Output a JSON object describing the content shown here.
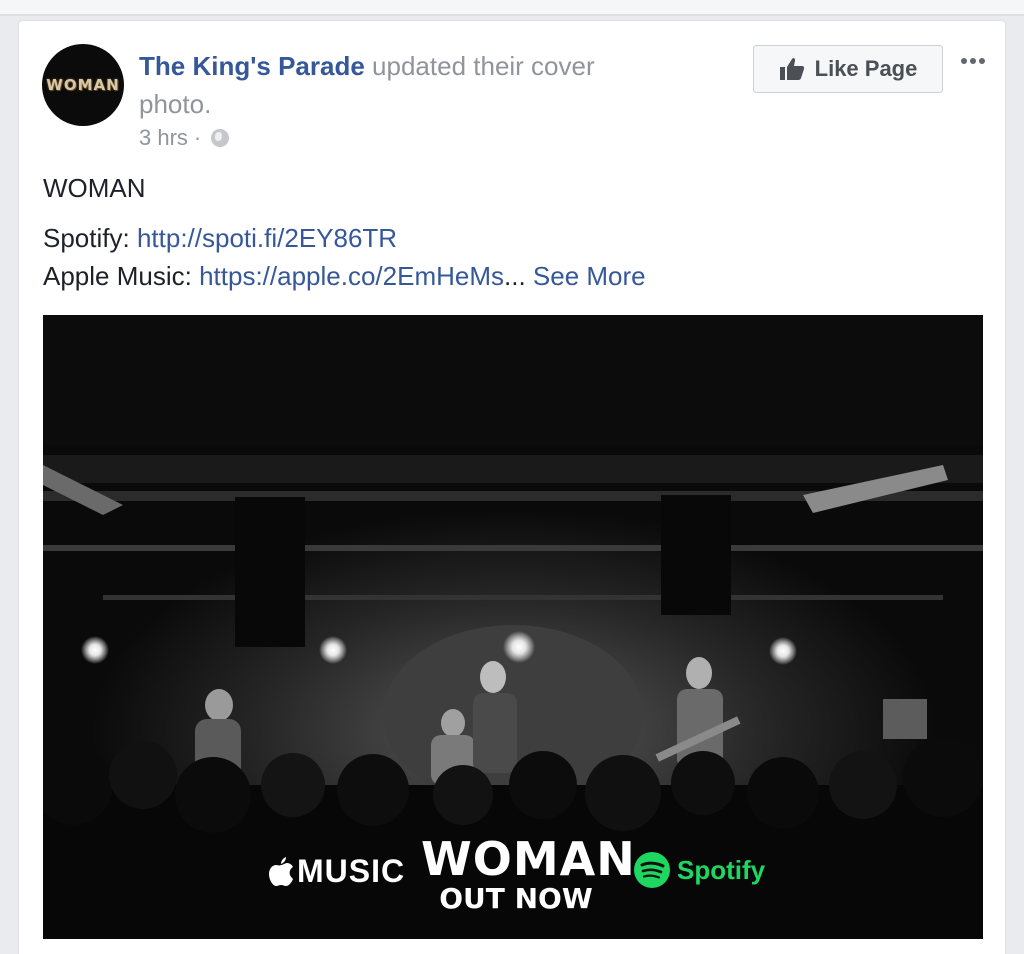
{
  "post": {
    "avatar_text": "WOMAN",
    "page_name": "The King's Parade",
    "action_text": "updated their cover photo.",
    "time": "3 hrs",
    "separator": "·",
    "privacy_icon": "globe-icon"
  },
  "actions": {
    "like_page_label": "Like Page",
    "like_icon": "thumbs-up-icon",
    "more_icon": "more-options-icon"
  },
  "body": {
    "title": "WOMAN",
    "spotify_label": "Spotify:",
    "spotify_link": "http://spoti.fi/2EY86TR",
    "apple_label": "Apple Music:",
    "apple_link": "https://apple.co/2EmHeMs",
    "ellipsis": "...",
    "see_more": "See More"
  },
  "photo": {
    "apple_music_label": "MUSIC",
    "release_title": "WOMAN",
    "release_status": "OUT NOW",
    "spotify_label": "Spotify"
  },
  "colors": {
    "link": "#365899",
    "meta": "#90949c",
    "spotify_green": "#1ed760"
  }
}
